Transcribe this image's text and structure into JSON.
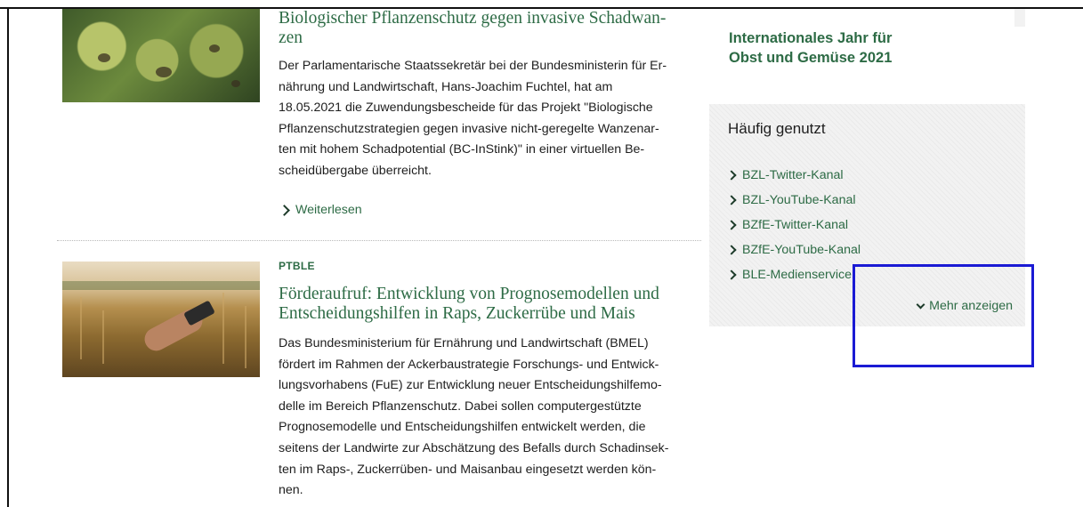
{
  "articles": [
    {
      "title": "Biologischer Pflanzenschutz gegen invasive Schadwan-\nzen",
      "body": "Der Parlamentarische Staatssekretär bei der Bundesministerin für Er-\nnährung und Landwirtschaft, Hans-Joachim Fuchtel, hat am\n18.05.2021 die Zuwendungsbescheide für das Projekt \"Biologische\nPflanzenschutzstrategien gegen invasive nicht-geregelte Wanzenar-\nten mit hohem Schadpotential (BC-InStink)\" in einer virtuellen Be-\nscheidübergabe überreicht.",
      "read_more": "Weiterlesen"
    },
    {
      "kicker": "PTBLE",
      "title": "Förderaufruf: Entwicklung von Prognosemodellen und\nEntscheidungshilfen in Raps, Zuckerrübe und Mais",
      "body": "Das Bundesministerium für Ernährung und Landwirtschaft (BMEL)\nfördert im Rahmen der Ackerbaustrategie Forschungs- und Entwick-\nlungsvorhabens (FuE) zur Entwicklung neuer Entscheidungshilfemo-\ndelle im Bereich Pflanzenschutz. Dabei sollen computergestützte\nPrognosemodelle und Entscheidungshilfen entwickelt werden, die\nseitens der Landwirte zur Abschätzung des Befalls durch Schadinsek-\nten im Raps-, Zuckerrüben- und Maisanbau eingesetzt werden kön-\nnen."
    }
  ],
  "sidebar": {
    "heading": "Internationales Jahr für\nObst und Gemüse 2021",
    "box": {
      "title": "Häufig genutzt",
      "links": [
        "BZL-Twitter-Kanal",
        "BZL-YouTube-Kanal",
        "BZfE-Twitter-Kanal",
        "BZfE-YouTube-Kanal",
        "BLE-Medienservice"
      ],
      "more": "Mehr anzeigen"
    }
  },
  "colors": {
    "accent_green": "#2d6b45",
    "highlight_blue": "#1a1ad4"
  }
}
